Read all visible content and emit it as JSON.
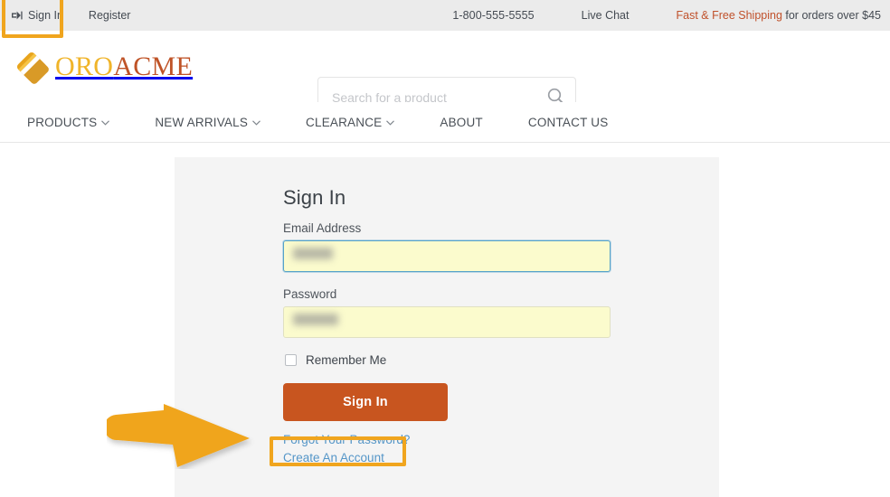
{
  "topbar": {
    "sign_in": "Sign In",
    "sign_in_icon": "sign-in-arrow-icon",
    "register": "Register",
    "phone": "1-800-555-5555",
    "live_chat": "Live Chat",
    "shipping_highlight": "Fast & Free Shipping",
    "shipping_rest": " for orders over $45",
    "background": "#ebebeb"
  },
  "brand": {
    "logo_primary": "ORO",
    "logo_secondary": "ACME",
    "logo_primary_color": "#f0b429",
    "logo_secondary_color": "#bf5327",
    "logo_mark_icon": "oro-diamond-logo-icon"
  },
  "search": {
    "placeholder": "Search for a product",
    "value": "",
    "icon": "search-icon"
  },
  "nav": {
    "items": [
      {
        "label": "PRODUCTS",
        "has_caret": true,
        "caret": "⌄"
      },
      {
        "label": "NEW ARRIVALS",
        "has_caret": true,
        "caret": "⌄"
      },
      {
        "label": "CLEARANCE",
        "has_caret": true,
        "caret": "⌄"
      },
      {
        "label": "ABOUT",
        "has_caret": false,
        "caret": ""
      },
      {
        "label": "CONTACT US",
        "has_caret": false,
        "caret": ""
      }
    ]
  },
  "signin_form": {
    "title": "Sign In",
    "email_label": "Email Address",
    "email_value": "",
    "email_focused": true,
    "password_label": "Password",
    "password_value": "",
    "remember_label": "Remember Me",
    "remember_checked": false,
    "submit_label": "Sign In",
    "forgot_link": "Forgot Your Password?",
    "create_link": "Create An Account",
    "panel_background": "#f4f4f4",
    "submit_color": "#c8551f",
    "link_color": "#5596c8",
    "autofill_color": "#fbfbcd"
  },
  "annotations": {
    "highlight_color": "#f0a51e",
    "arrow_color": "#f0a51e",
    "arrow_icon": "pointer-arrow-icon",
    "highlighted_elements": [
      "sign-in-topbar-link",
      "create-an-account-link"
    ]
  }
}
